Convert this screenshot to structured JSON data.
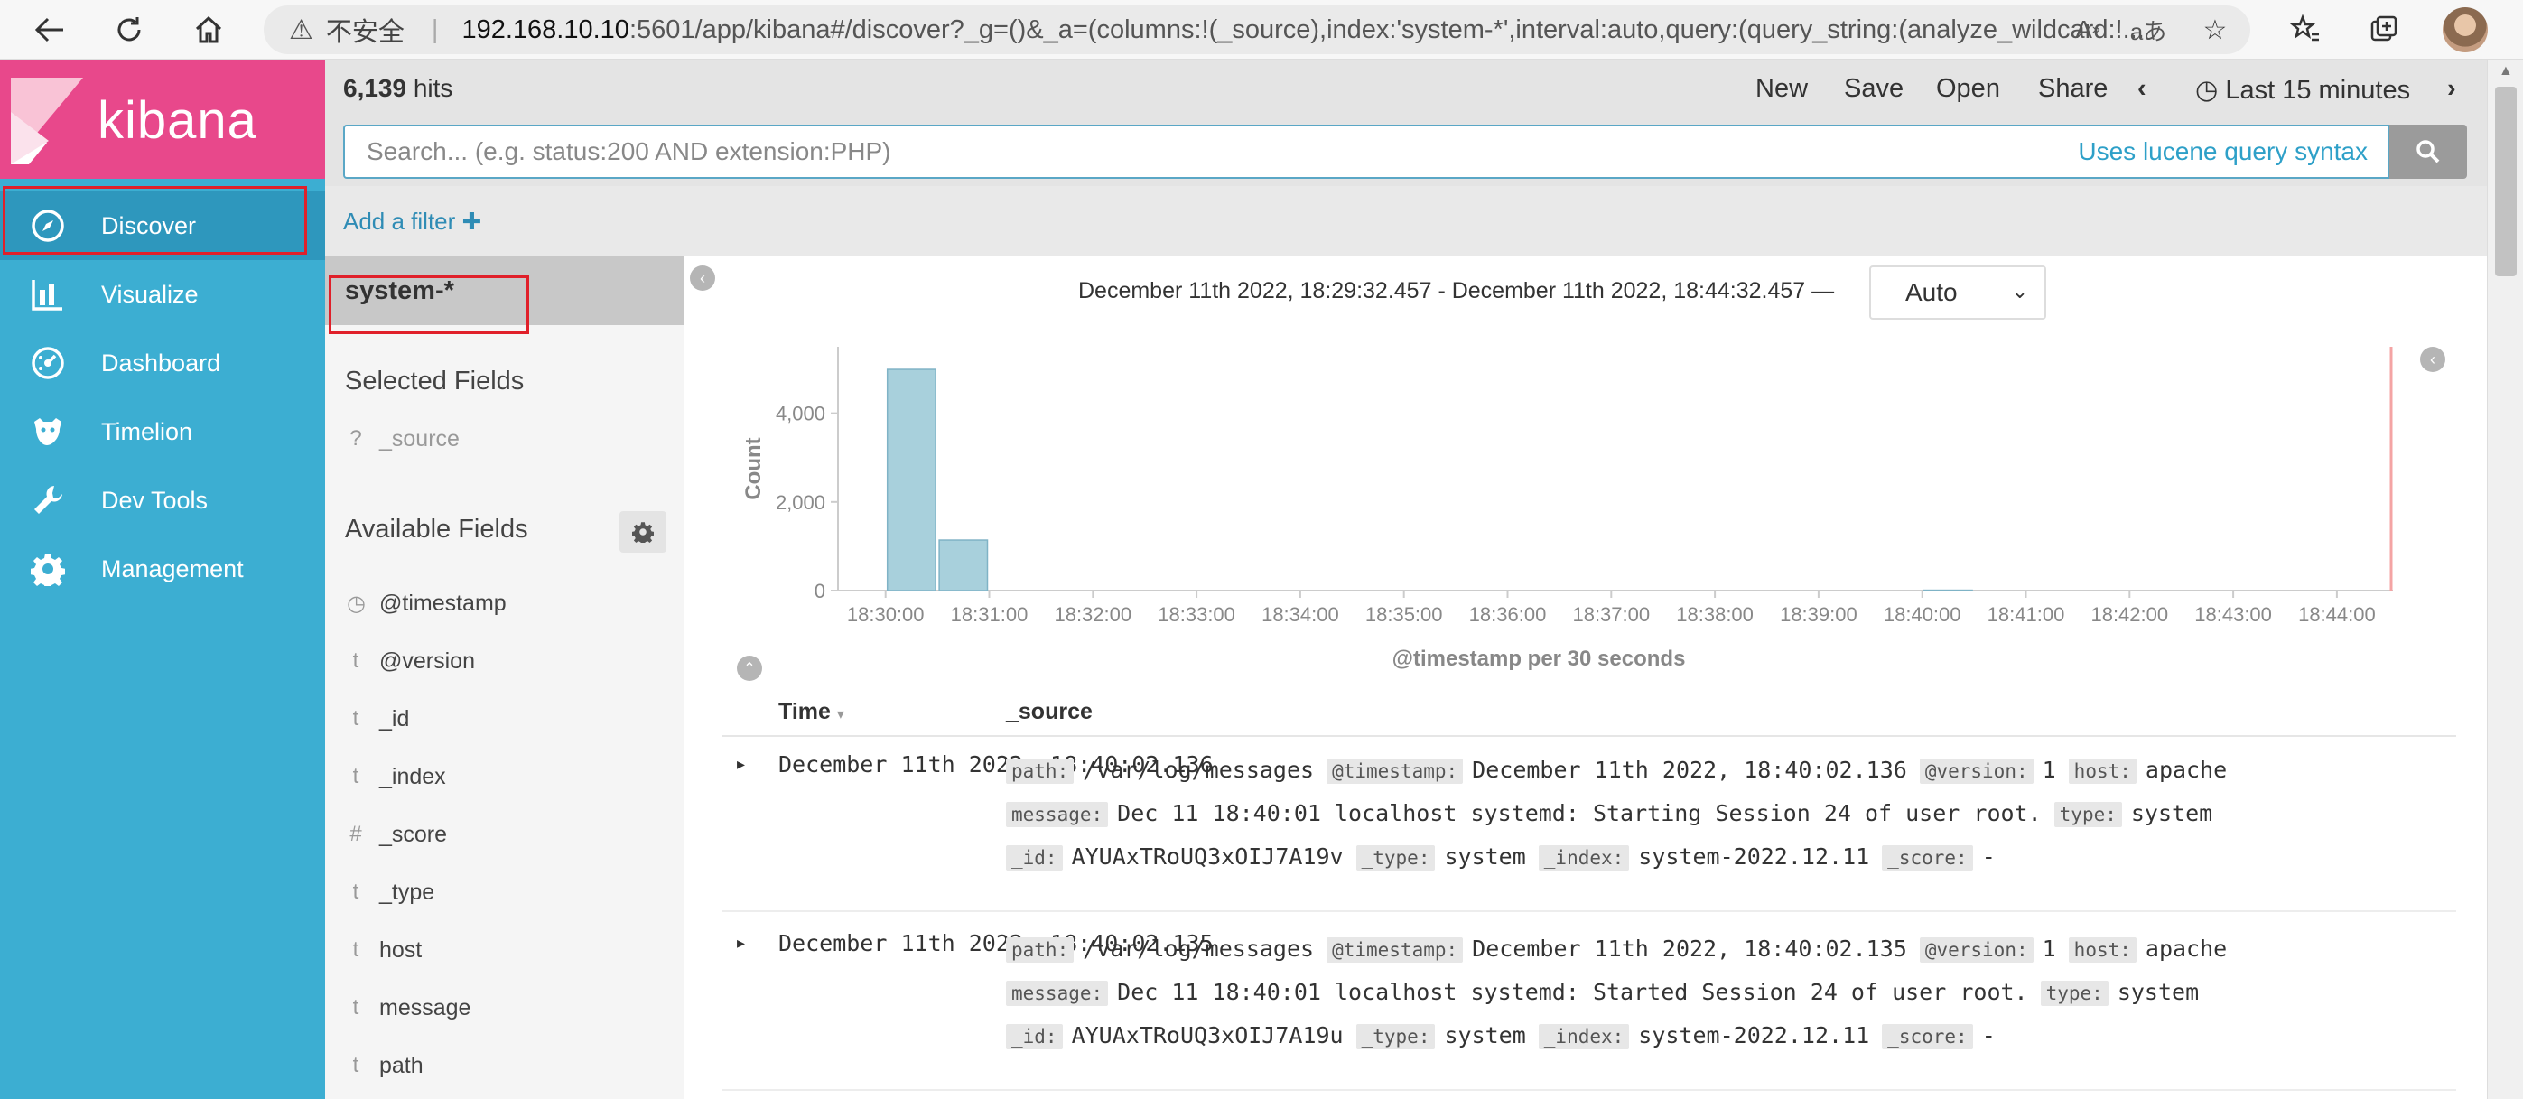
{
  "browser": {
    "security_icon": "warning-triangle-icon",
    "security_label": "不安全",
    "url_host": "192.168.10.10",
    "url_rest": ":5601/app/kibana#/discover?_g=()&_a=(columns:!(_source),index:'system-*',interval:auto,query:(query_string:(analyze_wildcard:!..."
  },
  "kibana": {
    "logo_text": "kibana",
    "brand_color": "#e8488b",
    "nav_color": "#3caed2"
  },
  "nav": {
    "items": [
      {
        "label": "Discover",
        "icon": "compass-icon"
      },
      {
        "label": "Visualize",
        "icon": "bar-chart-icon"
      },
      {
        "label": "Dashboard",
        "icon": "dashboard-gauge-icon"
      },
      {
        "label": "Timelion",
        "icon": "timelion-icon"
      },
      {
        "label": "Dev Tools",
        "icon": "wrench-icon"
      },
      {
        "label": "Management",
        "icon": "gear-icon"
      }
    ]
  },
  "top": {
    "hits_count": "6,139",
    "hits_label": "hits",
    "menu": {
      "new": "New",
      "save": "Save",
      "open": "Open",
      "share": "Share"
    },
    "time_label": "Last 15 minutes",
    "search_placeholder": "Search... (e.g. status:200 AND extension:PHP)",
    "lucene_link": "Uses lucene query syntax",
    "add_filter": "Add a filter"
  },
  "sidebar": {
    "index_pattern": "system-*",
    "selected_heading": "Selected Fields",
    "selected_fields": [
      {
        "type": "?",
        "name": "_source"
      }
    ],
    "available_heading": "Available Fields",
    "available_fields": [
      {
        "type": "◷",
        "name": "@timestamp"
      },
      {
        "type": "t",
        "name": "@version"
      },
      {
        "type": "t",
        "name": "_id"
      },
      {
        "type": "t",
        "name": "_index"
      },
      {
        "type": "#",
        "name": "_score"
      },
      {
        "type": "t",
        "name": "_type"
      },
      {
        "type": "t",
        "name": "host"
      },
      {
        "type": "t",
        "name": "message"
      },
      {
        "type": "t",
        "name": "path"
      }
    ]
  },
  "histogram": {
    "range_text": "December 11th 2022, 18:29:32.457 - December 11th 2022, 18:44:32.457 —",
    "interval_value": "Auto"
  },
  "chart_data": {
    "type": "bar",
    "ylabel": "Count",
    "xlabel": "@timestamp per 30 seconds",
    "y_ticks": [
      "0",
      "2,000",
      "4,000"
    ],
    "ylim": [
      0,
      5500
    ],
    "x_tick_labels": [
      "18:30:00",
      "18:31:00",
      "18:32:00",
      "18:33:00",
      "18:34:00",
      "18:35:00",
      "18:36:00",
      "18:37:00",
      "18:38:00",
      "18:39:00",
      "18:40:00",
      "18:41:00",
      "18:42:00",
      "18:43:00",
      "18:44:00"
    ],
    "categories": [
      "18:30:00",
      "18:30:30",
      "18:40:00"
    ],
    "values": [
      4990,
      1140,
      9
    ],
    "bar_color": "#a8d0dc",
    "now_marker_color": "#f4a4a4"
  },
  "table": {
    "col_time": "Time",
    "col_source": "_source",
    "rows": [
      {
        "time": "December 11th 2022, 18:40:02.136",
        "path": "/var/log/messages",
        "timestamp": "December 11th 2022, 18:40:02.136",
        "version": "1",
        "host": "apache",
        "message": "Dec 11 18:40:01 localhost systemd: Starting Session 24 of user root.",
        "type": "system",
        "id": "AYUAxTRoUQ3xOIJ7A19v",
        "_type": "system",
        "index": "system-2022.12.11",
        "score": "-"
      },
      {
        "time": "December 11th 2022, 18:40:02.135",
        "path": "/var/log/messages",
        "timestamp": "December 11th 2022, 18:40:02.135",
        "version": "1",
        "host": "apache",
        "message": "Dec 11 18:40:01 localhost systemd: Started Session 24 of user root.",
        "type": "system",
        "id": "AYUAxTRoUQ3xOIJ7A19u",
        "_type": "system",
        "index": "system-2022.12.11",
        "score": "-"
      }
    ],
    "keys": {
      "path": "path:",
      "timestamp": "@timestamp:",
      "version": "@version:",
      "host": "host:",
      "message": "message:",
      "type": "type:",
      "id": "_id:",
      "_type": "_type:",
      "index": "_index:",
      "score": "_score:"
    }
  }
}
